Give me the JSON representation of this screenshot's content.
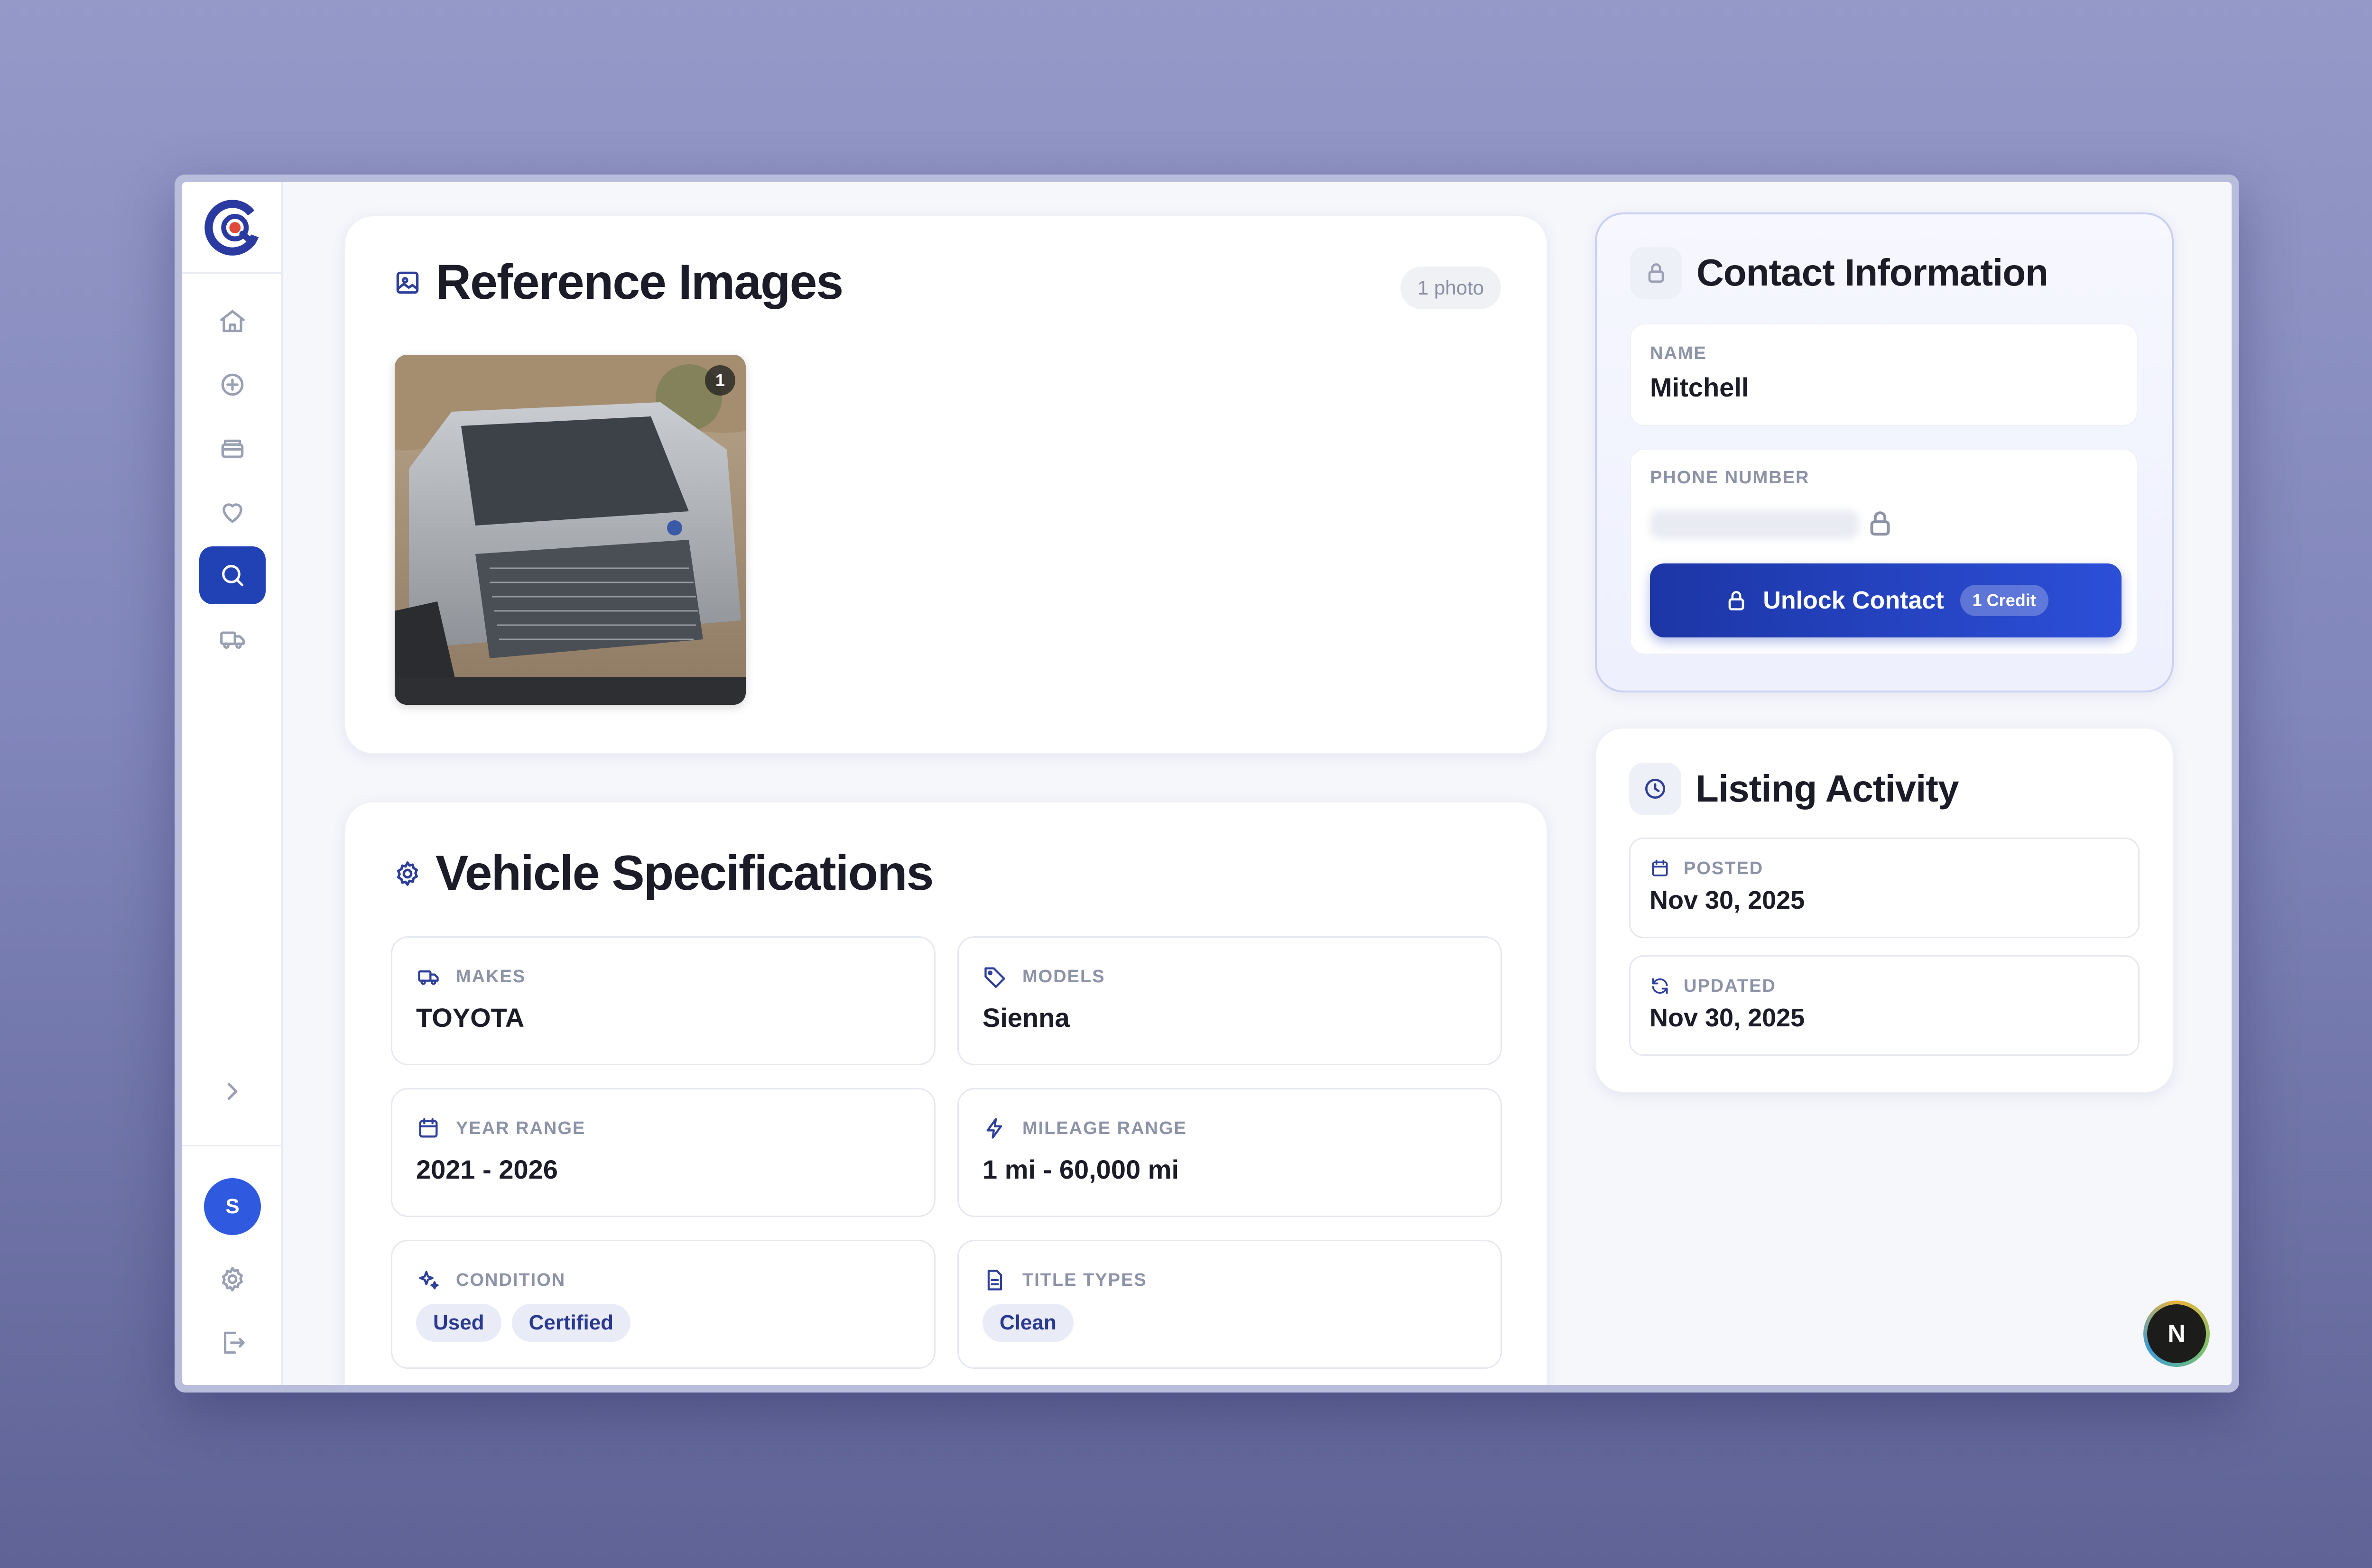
{
  "reference_images": {
    "title": "Reference Images",
    "photo_count_label": "1 photo",
    "photo_index": "1"
  },
  "vehicle_specs": {
    "title": "Vehicle Specifications",
    "makes": {
      "label": "MAKES",
      "value": "TOYOTA"
    },
    "models": {
      "label": "MODELS",
      "value": "Sienna"
    },
    "year_range": {
      "label": "YEAR RANGE",
      "value": "2021 - 2026"
    },
    "mileage_range": {
      "label": "MILEAGE RANGE",
      "value": "1 mi - 60,000 mi"
    },
    "condition": {
      "label": "CONDITION",
      "chips": [
        "Used",
        "Certified"
      ]
    },
    "title_types": {
      "label": "TITLE TYPES",
      "chips": [
        "Clean"
      ]
    }
  },
  "contact": {
    "title": "Contact Information",
    "name_label": "NAME",
    "name_value": "Mitchell",
    "phone_label": "PHONE NUMBER",
    "unlock_label": "Unlock Contact",
    "credit_label": "1 Credit"
  },
  "activity": {
    "title": "Listing Activity",
    "posted_label": "POSTED",
    "posted_value": "Nov 30, 2025",
    "updated_label": "UPDATED",
    "updated_value": "Nov 30, 2025"
  },
  "user": {
    "avatar_initial": "S"
  },
  "dev_badge": "N",
  "icons": {
    "sidebar": [
      "home-icon",
      "plus-circle-icon",
      "inbox-icon",
      "heart-icon",
      "search-icon",
      "truck-icon",
      "chevron-right-icon",
      "settings-icon",
      "logout-icon"
    ],
    "accent_color": "#2142b5"
  }
}
